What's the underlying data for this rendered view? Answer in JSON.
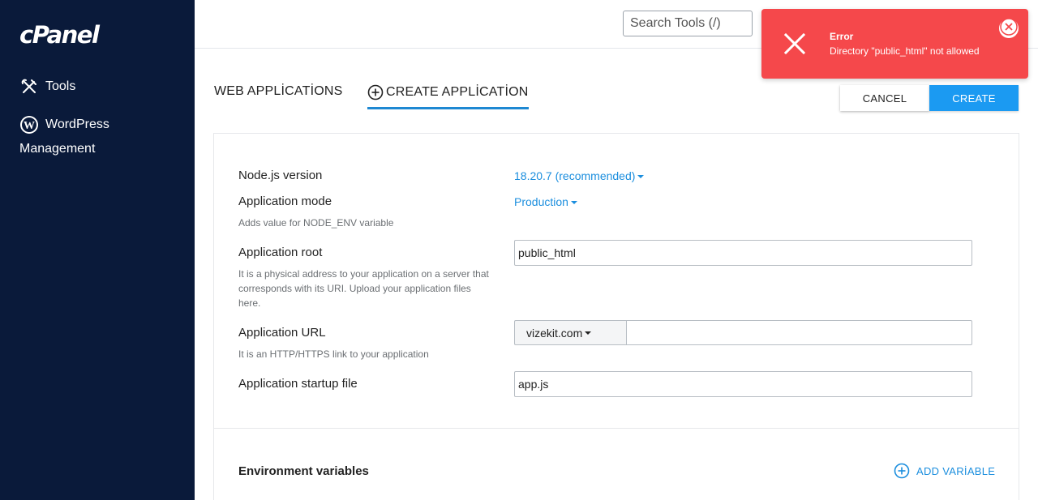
{
  "sidebar": {
    "logo": "cPanel",
    "items": [
      {
        "label": "Tools",
        "icon": "tools-icon"
      },
      {
        "label": "WordPress",
        "label_line2": "Management",
        "icon": "wordpress-icon"
      }
    ]
  },
  "header": {
    "search_placeholder": "Search Tools (/)"
  },
  "tabs": {
    "web_applications": "WEB APPLİCATİONS",
    "create_application": "CREATE APPLİCATİON"
  },
  "actions": {
    "cancel": "CANCEL",
    "create": "CREATE"
  },
  "toast": {
    "title": "Error",
    "message": "Directory \"public_html\" not allowed",
    "color": "#f5484b"
  },
  "form": {
    "nodejs_version": {
      "label": "Node.js version",
      "value": "18.20.7 (recommended)"
    },
    "app_mode": {
      "label": "Application mode",
      "value": "Production",
      "help": "Adds value for NODE_ENV variable"
    },
    "app_root": {
      "label": "Application root",
      "value": "public_html",
      "help": "It is a physical address to your application on a server that corresponds with its URI. Upload your application files here."
    },
    "app_url": {
      "label": "Application URL",
      "domain": "vizekit.com",
      "path": "",
      "help": "It is an HTTP/HTTPS link to your application"
    },
    "startup_file": {
      "label": "Application startup file",
      "value": "app.js"
    }
  },
  "env": {
    "title": "Environment variables",
    "add_label": "ADD VARİABLE"
  },
  "colors": {
    "sidebar_bg": "#0a1a3a",
    "accent": "#1b9af2",
    "link": "#1b8ede"
  }
}
